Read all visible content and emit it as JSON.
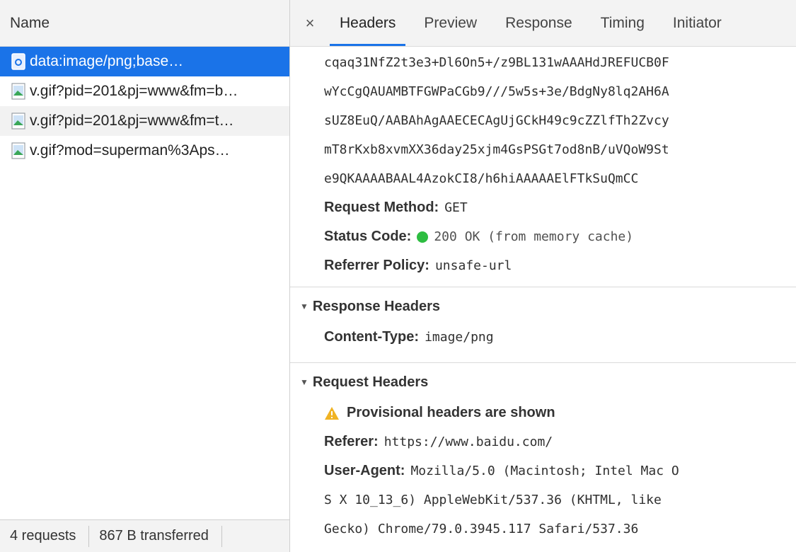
{
  "left": {
    "header": "Name",
    "requests": [
      {
        "label": "data:image/png;base…",
        "icon": "data-uri-icon",
        "selected": true
      },
      {
        "label": "v.gif?pid=201&pj=www&fm=b…",
        "icon": "image-file-icon",
        "selected": false
      },
      {
        "label": "v.gif?pid=201&pj=www&fm=t…",
        "icon": "image-file-icon",
        "selected": false
      },
      {
        "label": "v.gif?mod=superman%3Aps…",
        "icon": "image-file-icon",
        "selected": false
      }
    ],
    "status": {
      "requests": "4 requests",
      "transferred": "867 B transferred"
    }
  },
  "tabs": {
    "close": "×",
    "items": [
      "Headers",
      "Preview",
      "Response",
      "Timing",
      "Initiator"
    ],
    "active": "Headers"
  },
  "general": {
    "url_lines": [
      "cqaq31NfZ2t3e3+Dl6On5+/z9BL131wAAAHdJREFUCB0F",
      "wYcCgQAUAMBTFGWPaCGb9///5w5s+3e/BdgNy8lq2AH6A",
      "sUZ8EuQ/AABAhAgAAECECAgUjGCkH49c9cZZlfTh2Zvcy",
      "mT8rKxb8xvmXX36day25xjm4GsPSGt7od8nB/uVQoW9St",
      "e9QKAAAABAAL4AzokCI8/h6hiAAAAAElFTkSuQmCC"
    ],
    "method_key": "Request Method:",
    "method_val": "GET",
    "status_key": "Status Code:",
    "status_val": "200 OK (from memory cache)",
    "referrer_policy_key": "Referrer Policy:",
    "referrer_policy_val": "unsafe-url"
  },
  "response_headers": {
    "title": "Response Headers",
    "content_type_key": "Content-Type:",
    "content_type_val": "image/png"
  },
  "request_headers": {
    "title": "Request Headers",
    "warning": "Provisional headers are shown",
    "referer_key": "Referer:",
    "referer_val": "https://www.baidu.com/",
    "ua_key": "User-Agent:",
    "ua_lines": [
      "Mozilla/5.0 (Macintosh; Intel Mac O",
      "S X 10_13_6) AppleWebKit/537.36 (KHTML, like",
      "Gecko) Chrome/79.0.3945.117 Safari/537.36"
    ]
  },
  "colors": {
    "selection": "#1a73e8",
    "status_ok": "#2dbd41",
    "warning": "#f0b323"
  }
}
